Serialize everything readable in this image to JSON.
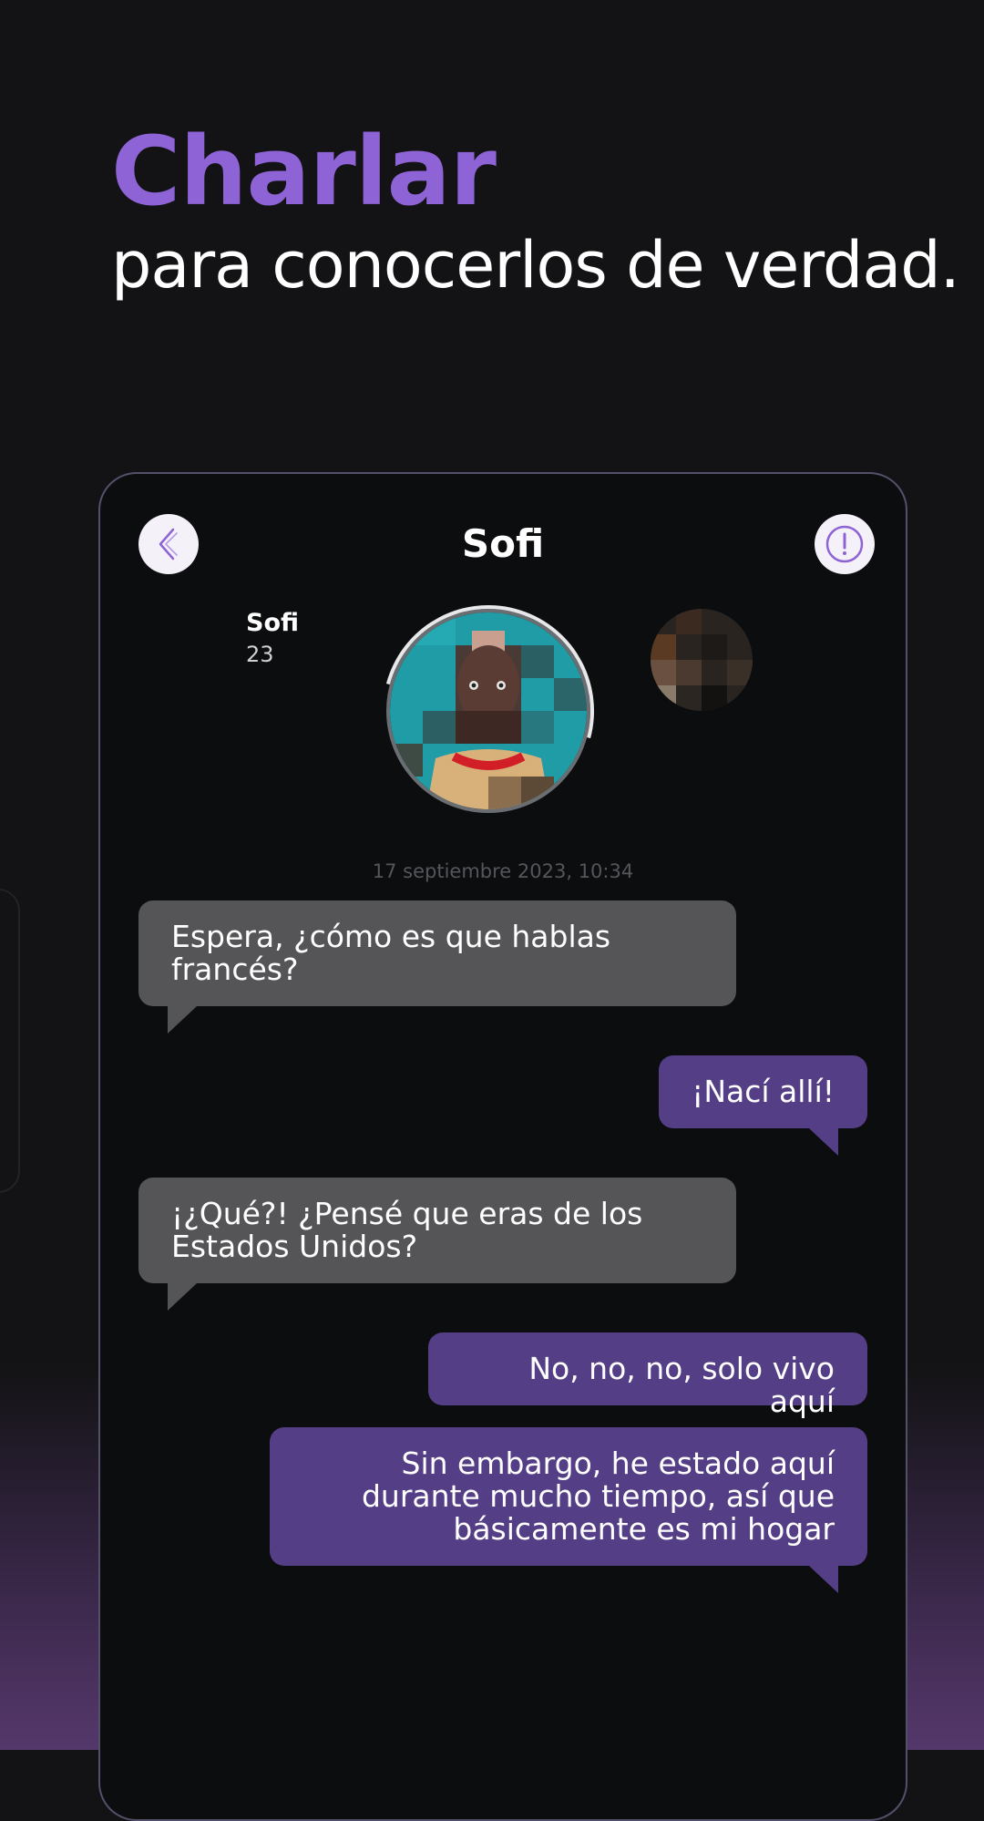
{
  "headline": {
    "title": "Charlar",
    "subtitle": "para conocerlos de verdad."
  },
  "chat": {
    "header_title": "Sofi",
    "profile": {
      "name": "Sofi",
      "age": "23"
    },
    "timestamp": "17 septiembre 2023, 10:34",
    "messages": [
      {
        "direction": "in",
        "text": "Espera, ¿cómo es que hablas francés?"
      },
      {
        "direction": "out",
        "text": "¡Nací allí!"
      },
      {
        "direction": "in",
        "text": "¡¿Qué?! ¿Pensé que eras de los Estados Unidos?"
      },
      {
        "direction": "out",
        "text": "No, no, no, solo vivo aquí"
      },
      {
        "direction": "out",
        "text": "Sin embargo, he estado aquí durante mucho tiempo, así que básicamente es mi hogar"
      }
    ]
  },
  "icons": {
    "back": "chevron-left-icon",
    "report": "exclamation-circle-icon"
  },
  "colors": {
    "accent": "#8e63d6",
    "outgoing_bubble": "#543f86",
    "incoming_bubble": "#555558",
    "background": "#131315"
  }
}
